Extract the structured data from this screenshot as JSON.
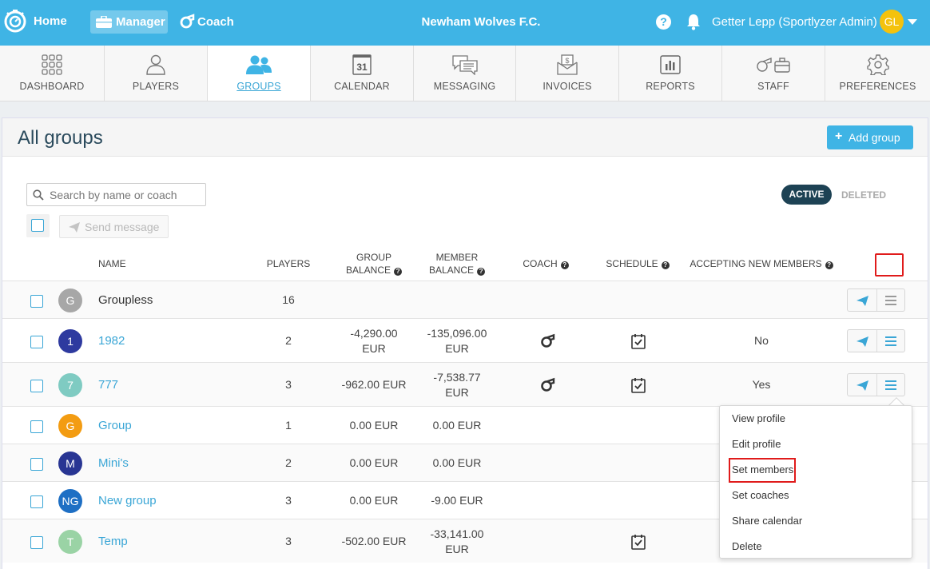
{
  "topbar": {
    "home_label": "Home",
    "manager_label": "Manager",
    "coach_label": "Coach",
    "club_name": "Newham Wolves F.C.",
    "help_label": "?",
    "user_name": "Getter Lepp (Sportlyzer Admin)",
    "user_initials": "GL"
  },
  "nav": [
    {
      "label": "DASHBOARD",
      "icon": "grid-icon"
    },
    {
      "label": "PLAYERS",
      "icon": "person-icon"
    },
    {
      "label": "GROUPS",
      "icon": "group-icon",
      "active": true
    },
    {
      "label": "CALENDAR",
      "icon": "calendar-icon",
      "day": "31"
    },
    {
      "label": "MESSAGING",
      "icon": "chat-icon"
    },
    {
      "label": "INVOICES",
      "icon": "invoice-icon"
    },
    {
      "label": "REPORTS",
      "icon": "report-icon"
    },
    {
      "label": "STAFF",
      "icon": "staff-icon"
    },
    {
      "label": "PREFERENCES",
      "icon": "gear-icon"
    }
  ],
  "page": {
    "title": "All groups",
    "add_button": "Add group",
    "search_placeholder": "Search by name or coach",
    "filter_active": "ACTIVE",
    "filter_deleted": "DELETED",
    "send_message": "Send message"
  },
  "columns": {
    "name": "NAME",
    "players": "PLAYERS",
    "group_balance_1": "GROUP",
    "group_balance_2": "BALANCE",
    "member_balance_1": "MEMBER",
    "member_balance_2": "BALANCE",
    "coach": "COACH",
    "schedule": "SCHEDULE",
    "accepting": "ACCEPTING NEW MEMBERS"
  },
  "rows": [
    {
      "initials": "G",
      "color": "#a7a7a7",
      "name": "Groupless",
      "players": "16",
      "group_balance": [
        "",
        ""
      ],
      "member_balance": [
        "",
        ""
      ],
      "coach": false,
      "schedule": false,
      "accepting": "",
      "link": false
    },
    {
      "initials": "1",
      "color": "#2e3a9f",
      "name": "1982",
      "players": "2",
      "group_balance": [
        "-4,290.00",
        "EUR"
      ],
      "member_balance": [
        "-135,096.00",
        "EUR"
      ],
      "coach": true,
      "schedule": true,
      "accepting": "No",
      "link": true
    },
    {
      "initials": "7",
      "color": "#7fcbc2",
      "name": "777",
      "players": "3",
      "group_balance": [
        "-962.00 EUR",
        ""
      ],
      "member_balance": [
        "-7,538.77",
        "EUR"
      ],
      "coach": true,
      "schedule": true,
      "accepting": "Yes",
      "link": true
    },
    {
      "initials": "G",
      "color": "#f39c12",
      "name": "Group",
      "players": "1",
      "group_balance": [
        "0.00 EUR",
        ""
      ],
      "member_balance": [
        "0.00 EUR",
        ""
      ],
      "coach": false,
      "schedule": false,
      "accepting": "",
      "link": true
    },
    {
      "initials": "M",
      "color": "#283593",
      "name": "Mini's",
      "players": "2",
      "group_balance": [
        "0.00 EUR",
        ""
      ],
      "member_balance": [
        "0.00 EUR",
        ""
      ],
      "coach": false,
      "schedule": false,
      "accepting": "",
      "link": true
    },
    {
      "initials": "NG",
      "color": "#1e6fc4",
      "name": "New group",
      "players": "3",
      "group_balance": [
        "0.00 EUR",
        ""
      ],
      "member_balance": [
        "-9.00 EUR",
        ""
      ],
      "coach": false,
      "schedule": false,
      "accepting": "",
      "link": true
    },
    {
      "initials": "T",
      "color": "#9ad3a5",
      "name": "Temp",
      "players": "3",
      "group_balance": [
        "-502.00 EUR",
        ""
      ],
      "member_balance": [
        "-33,141.00",
        "EUR"
      ],
      "coach": false,
      "schedule": true,
      "accepting": "",
      "link": true
    }
  ],
  "dropdown": [
    "View profile",
    "Edit profile",
    "Set members",
    "Set coaches",
    "Share calendar",
    "Delete"
  ],
  "colors": {
    "accent": "#3fb4e5",
    "highlight": "#e01b1b",
    "dark": "#1d4254"
  }
}
